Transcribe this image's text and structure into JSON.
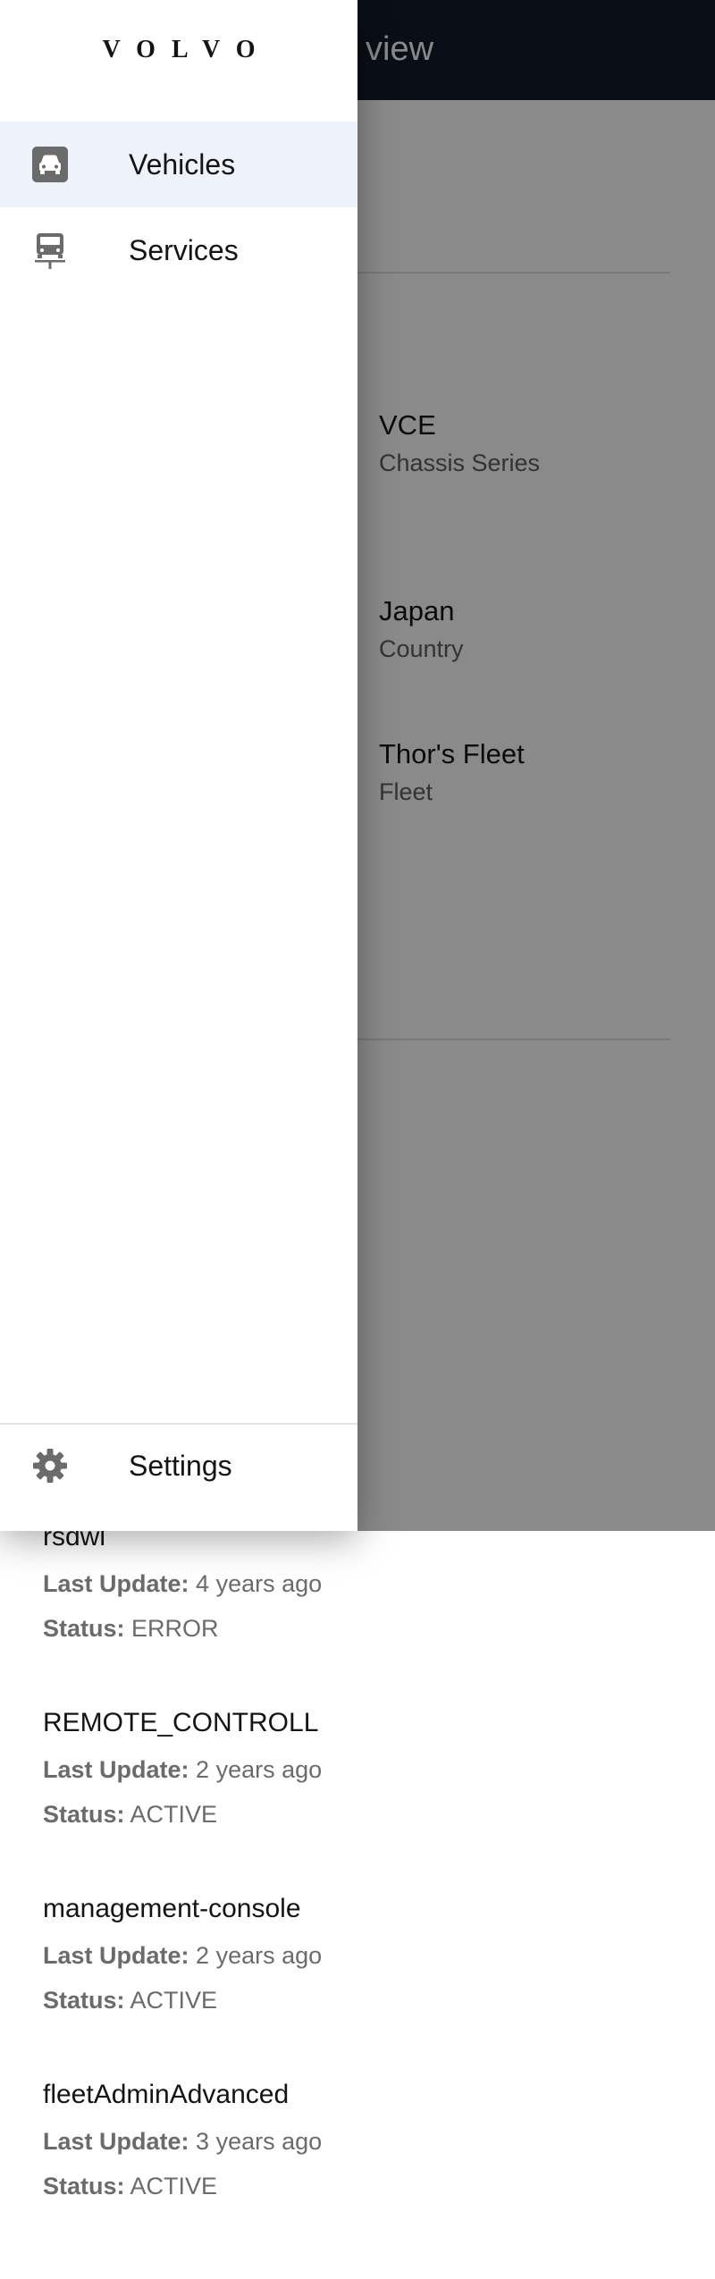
{
  "header": {
    "title_fragment": "l view"
  },
  "attributes": [
    {
      "value": "VCE",
      "label": "Chassis Series"
    },
    {
      "value": "Japan",
      "label": "Country"
    },
    {
      "value": "Thor's Fleet",
      "label": "Fleet"
    }
  ],
  "services": [
    {
      "name": "rsdwl",
      "last_update_label": "Last Update:",
      "last_update": "4 years ago",
      "status_label": "Status:",
      "status": "ERROR"
    },
    {
      "name": "REMOTE_CONTROLL",
      "last_update_label": "Last Update:",
      "last_update": "2 years ago",
      "status_label": "Status:",
      "status": "ACTIVE"
    },
    {
      "name": "management-console",
      "last_update_label": "Last Update:",
      "last_update": "2 years ago",
      "status_label": "Status:",
      "status": "ACTIVE"
    },
    {
      "name": "fleetAdminAdvanced",
      "last_update_label": "Last Update:",
      "last_update": "3 years ago",
      "status_label": "Status:",
      "status": "ACTIVE"
    }
  ],
  "drawer": {
    "logo": "VOLVO",
    "items": [
      {
        "label": "Vehicles",
        "icon": "car-icon",
        "active": true
      },
      {
        "label": "Services",
        "icon": "bus-stop-icon",
        "active": false
      }
    ],
    "settings": {
      "label": "Settings",
      "icon": "gear-icon"
    }
  },
  "colors": {
    "app_bar": "#141a29",
    "active_item_bg": "#eef3fb",
    "icon_gray": "#6b6b6b",
    "scrim": "rgba(0,0,0,0.46)"
  }
}
